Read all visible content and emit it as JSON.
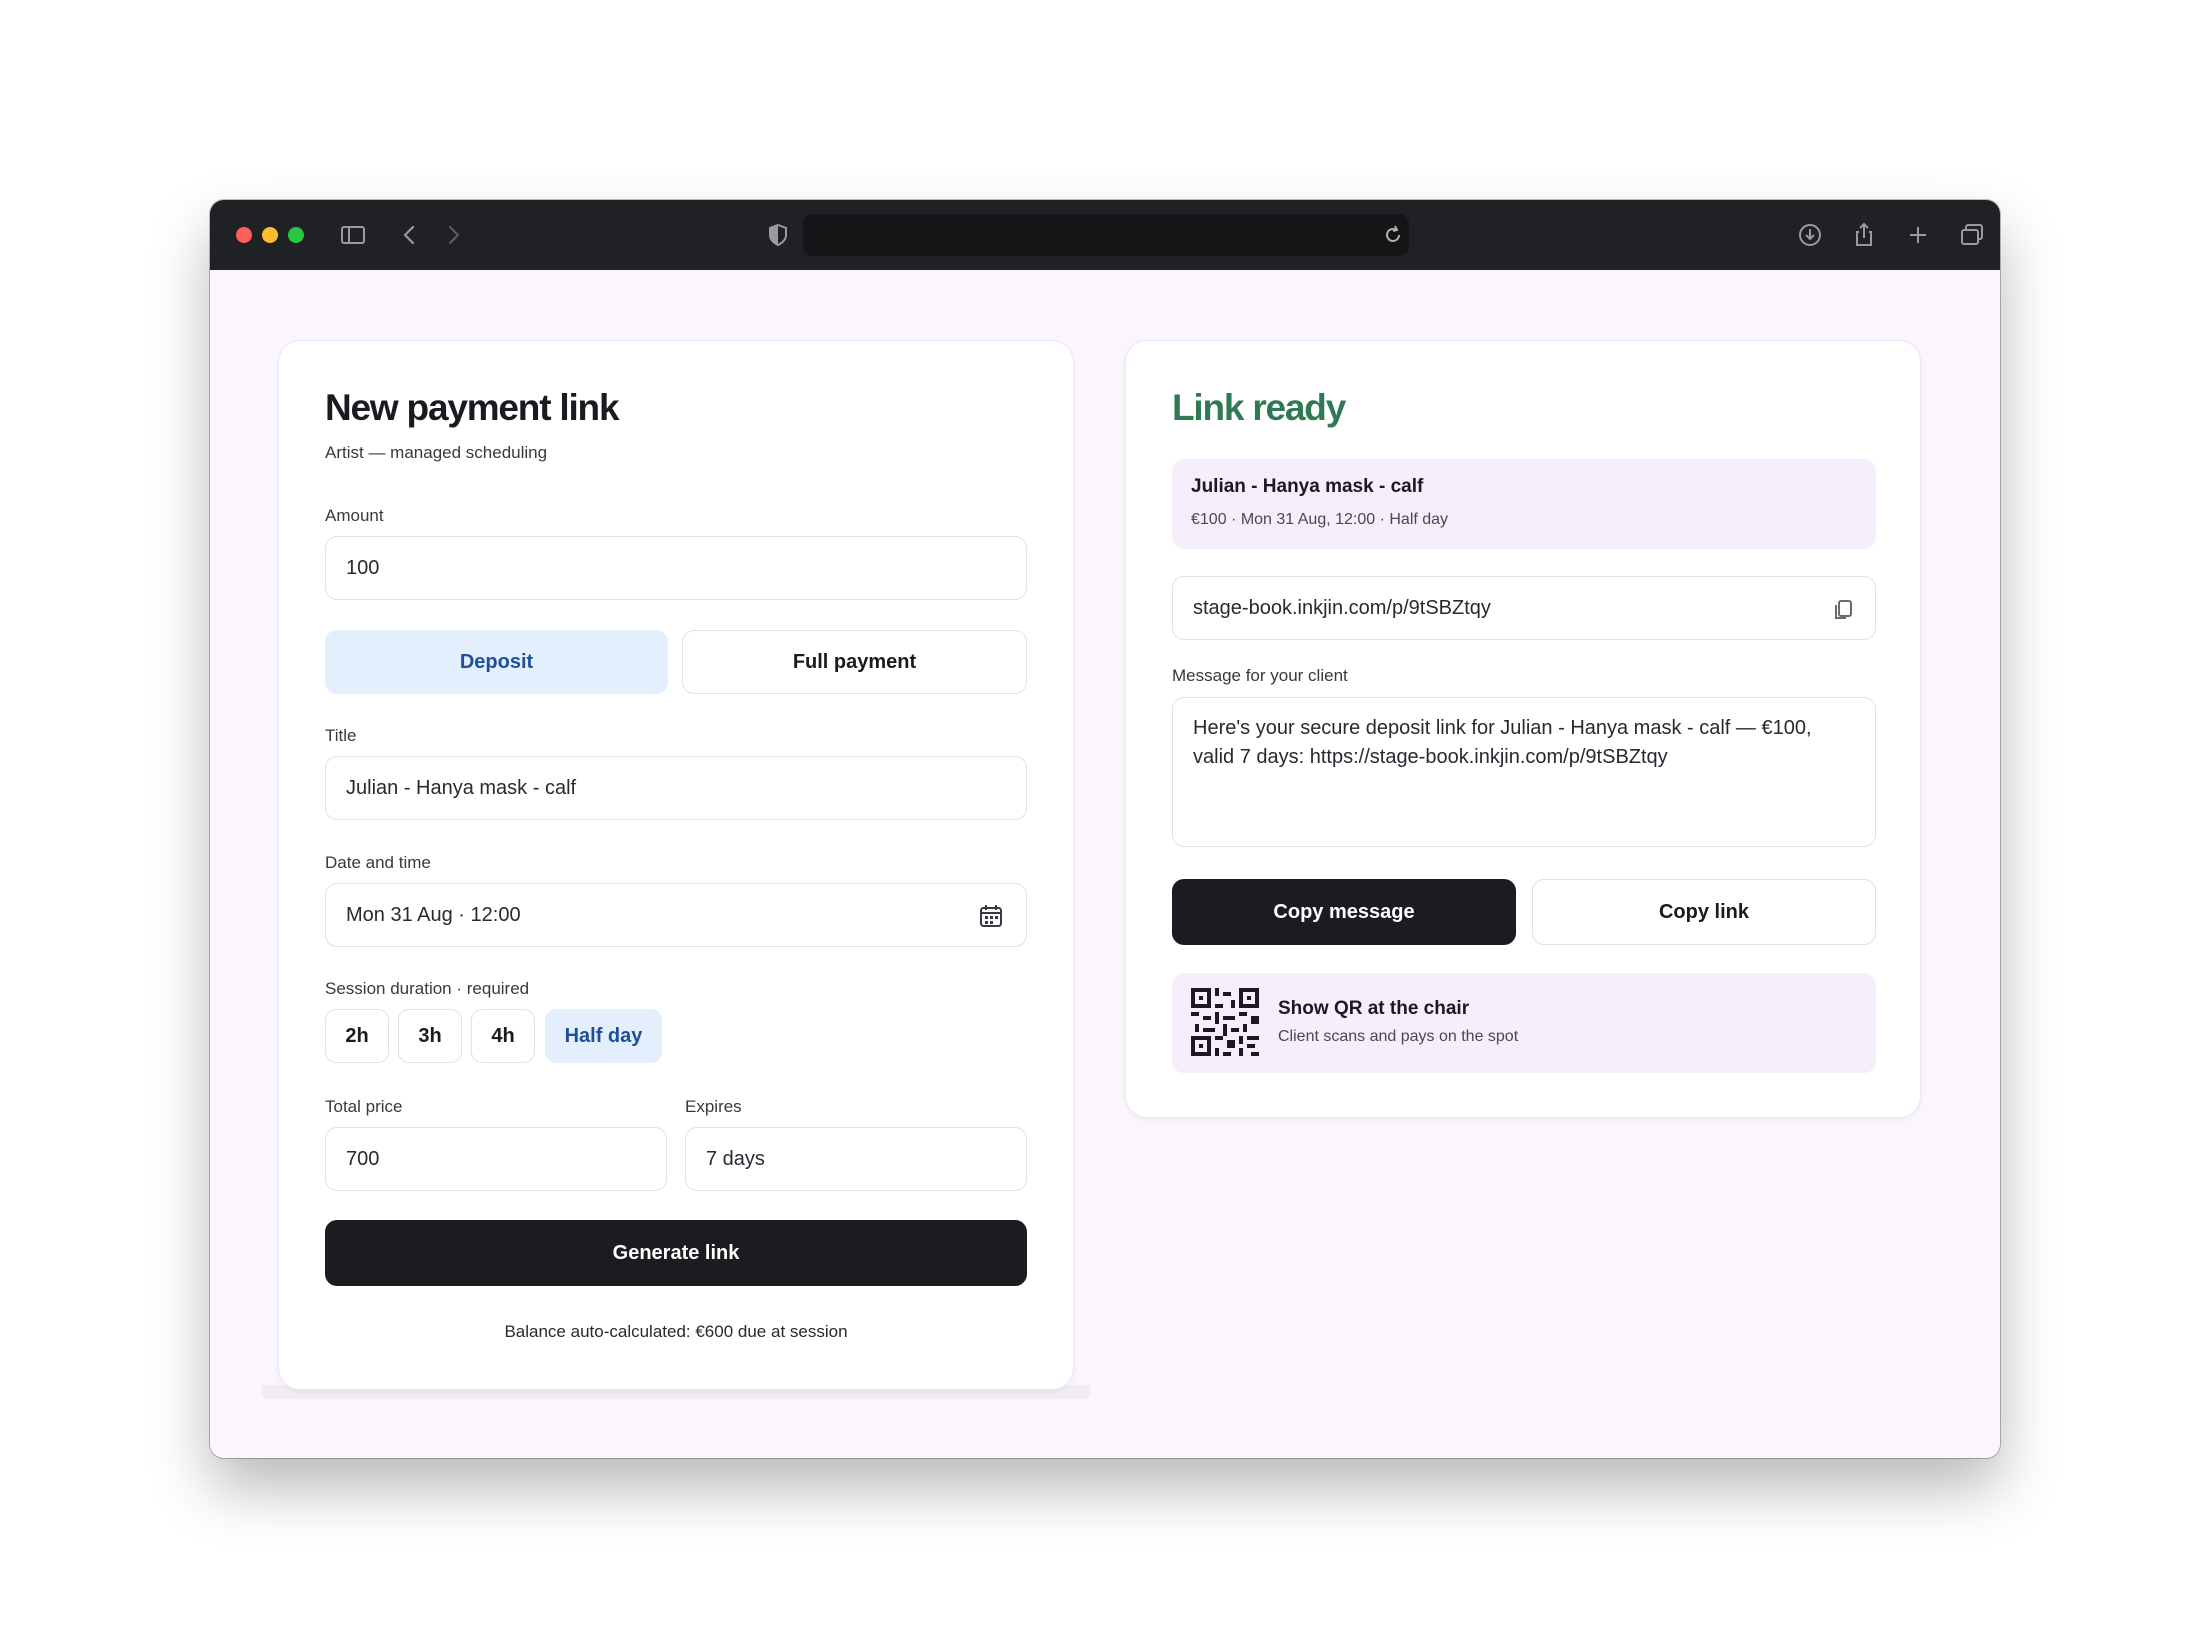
{
  "browser": {
    "icons": [
      "sidebar-toggle-icon",
      "back-arrow-icon",
      "forward-arrow-icon",
      "shield-icon",
      "reload-icon",
      "download-icon",
      "share-icon",
      "new-tab-plus-icon",
      "tabs-overview-icon"
    ]
  },
  "form": {
    "title": "New payment link",
    "subtitle": "Artist — managed scheduling",
    "amount_label": "Amount",
    "amount_value": "100",
    "type_options": [
      "Deposit",
      "Full payment"
    ],
    "type_selected": "Deposit",
    "title_label": "Title",
    "title_value": "Julian - Hanya mask - calf",
    "datetime_label": "Date and time",
    "datetime_value": "Mon 31 Aug · 12:00",
    "duration_label": "Session duration · required",
    "durations": [
      "2h",
      "3h",
      "4h",
      "Half day"
    ],
    "duration_selected": "Half day",
    "total_label": "Total price",
    "total_value": "700",
    "expires_label": "Expires",
    "expires_value": "7 days",
    "generate_label": "Generate link",
    "balance_note": "Balance auto-calculated: €600 due at session"
  },
  "result": {
    "title": "Link ready",
    "summary_title": "Julian - Hanya mask - calf",
    "summary_meta": "€100 · Mon 31 Aug, 12:00 · Half day",
    "link": "stage-book.inkjin.com/p/9tSBZtqy",
    "message_label": "Message for your client",
    "message": "Here's your secure deposit link for Julian - Hanya mask - calf — €100, valid 7 days: https://stage-book.inkjin.com/p/9tSBZtqy",
    "copy_message_label": "Copy message",
    "copy_link_label": "Copy link",
    "qr_title": "Show QR at the chair",
    "qr_subtitle": "Client scans and pays on the spot"
  },
  "colors": {
    "accent_green": "#2f7a52",
    "selected_bg": "#e3effd",
    "selected_text": "#1f4f9a",
    "dark_button": "#1c1b20",
    "page_bg": "#fbf6fd"
  }
}
